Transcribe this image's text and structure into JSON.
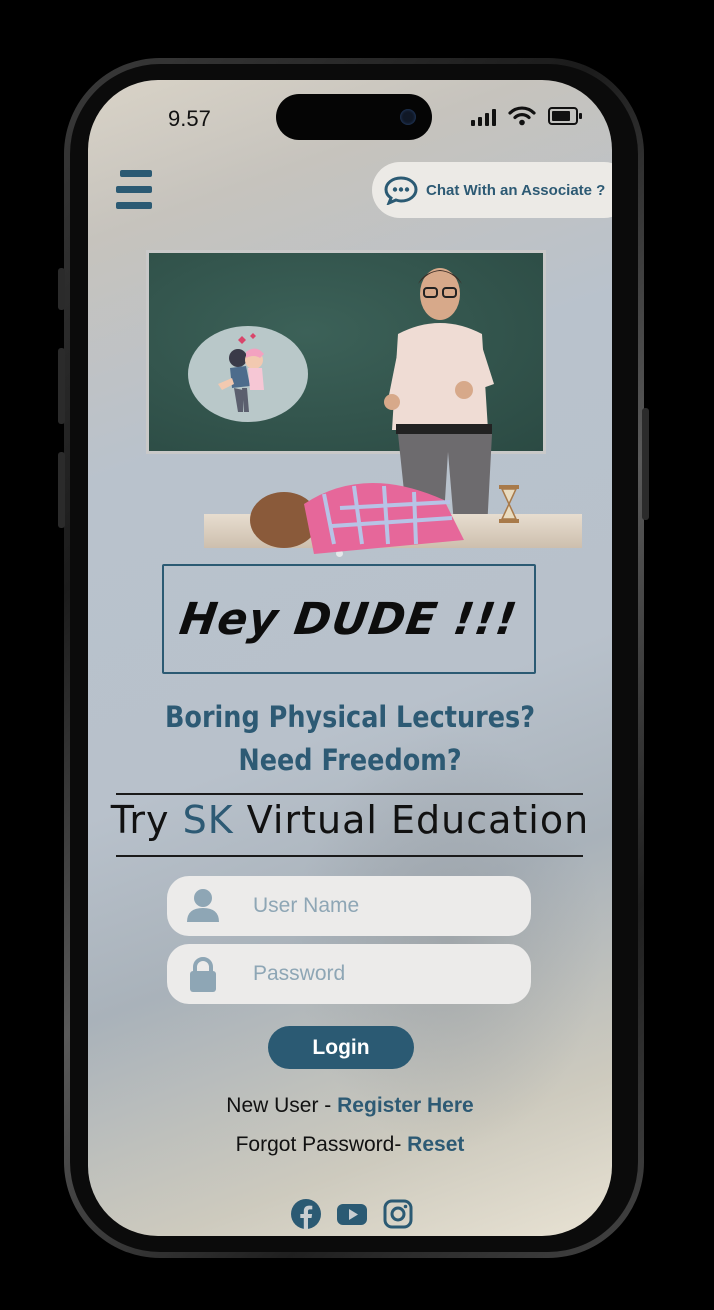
{
  "status_bar": {
    "time": "9.57"
  },
  "header": {
    "menu_icon": "hamburger-menu-icon",
    "chat_button_label": "Chat With an Associate ?",
    "chat_icon": "chat-bubble-icon"
  },
  "hero": {
    "illustration": "teacher-in-classroom-image",
    "greeting": "Hey DUDE !!!",
    "tagline_line1": "Boring Physical Lectures?",
    "tagline_line2": "Need Freedom?",
    "try_prefix": "Try ",
    "try_brand": "SK",
    "try_suffix": " Virtual Education"
  },
  "login_form": {
    "username_placeholder": "User Name",
    "password_placeholder": "Password",
    "login_label": "Login"
  },
  "links": {
    "new_user_text": "New User - ",
    "register_label": "Register Here",
    "forgot_text": "Forgot Password- ",
    "reset_label": "Reset"
  },
  "social": {
    "icons": [
      "facebook-icon",
      "youtube-icon",
      "instagram-icon"
    ]
  },
  "colors": {
    "accent": "#2B5A73",
    "field_bg": "#ECEBEA",
    "placeholder": "#8EA6B5"
  }
}
